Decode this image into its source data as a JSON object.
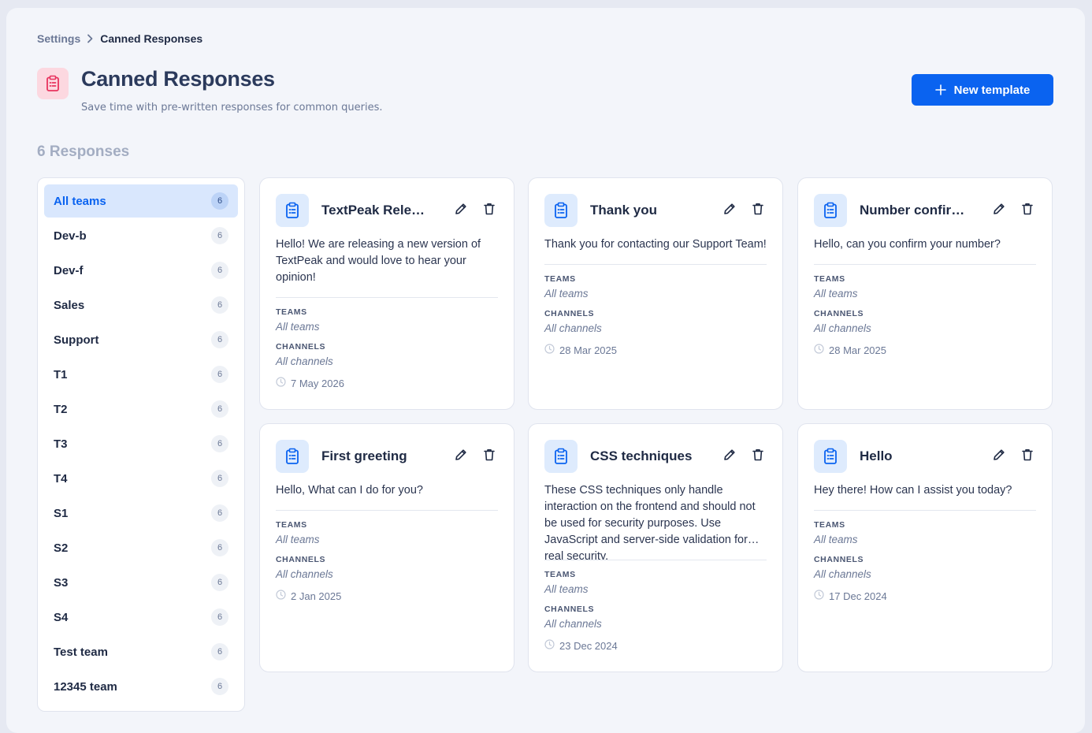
{
  "breadcrumb": {
    "parent": "Settings",
    "separator": "›",
    "current": "Canned Responses"
  },
  "header": {
    "title": "Canned Responses",
    "subtitle": "Save time with pre-written responses for common queries.",
    "new_button_label": "New template",
    "new_button_icon": "plus-icon"
  },
  "responses_count_label": "6 Responses",
  "teams": [
    {
      "label": "All teams",
      "count": "6",
      "active": true
    },
    {
      "label": "Dev-b",
      "count": "6"
    },
    {
      "label": "Dev-f",
      "count": "6"
    },
    {
      "label": "Sales",
      "count": "6"
    },
    {
      "label": "Support",
      "count": "6"
    },
    {
      "label": "T1",
      "count": "6"
    },
    {
      "label": "T2",
      "count": "6"
    },
    {
      "label": "T3",
      "count": "6"
    },
    {
      "label": "T4",
      "count": "6"
    },
    {
      "label": "S1",
      "count": "6"
    },
    {
      "label": "S2",
      "count": "6"
    },
    {
      "label": "S3",
      "count": "6"
    },
    {
      "label": "S4",
      "count": "6"
    },
    {
      "label": "Test team",
      "count": "6"
    },
    {
      "label": "12345 team",
      "count": "6"
    }
  ],
  "labels": {
    "teams": "TEAMS",
    "channels": "CHANNELS"
  },
  "cards": [
    {
      "title": "TextPeak Release",
      "body": "Hello! We are releasing a new version of TextPeak and would love to hear your opinion!",
      "teams": "All teams",
      "channels": "All channels",
      "date": "7 May 2026"
    },
    {
      "title": "Thank you",
      "body": "Thank you for contacting our Support Team!",
      "teams": "All teams",
      "channels": "All channels",
      "date": "28 Mar 2025"
    },
    {
      "title": "Number confirmation",
      "body": "Hello, can you confirm your number?",
      "teams": "All teams",
      "channels": "All channels",
      "date": "28 Mar 2025"
    },
    {
      "title": "First greeting",
      "body": "Hello, What can I do for you?",
      "teams": "All teams",
      "channels": "All channels",
      "date": "2 Jan 2025"
    },
    {
      "title": "CSS techniques",
      "body": "These CSS techniques only handle interaction on the frontend and should not be used for security purposes. Use JavaScript and server-side validation for real security.",
      "teams": "All teams",
      "channels": "All channels",
      "date": "23 Dec 2024"
    },
    {
      "title": "Hello",
      "body": "Hey there! How can I assist you today?",
      "teams": "All teams",
      "channels": "All channels",
      "date": "17 Dec 2024"
    }
  ],
  "colors": {
    "accent": "#0a63f0",
    "title_icon_bg": "#fcd8e0",
    "title_icon": "#e8335e"
  },
  "icons": {
    "title": "clipboard-icon",
    "card": "clipboard-icon",
    "edit": "pencil-icon",
    "delete": "trash-icon",
    "date": "clock-icon"
  }
}
